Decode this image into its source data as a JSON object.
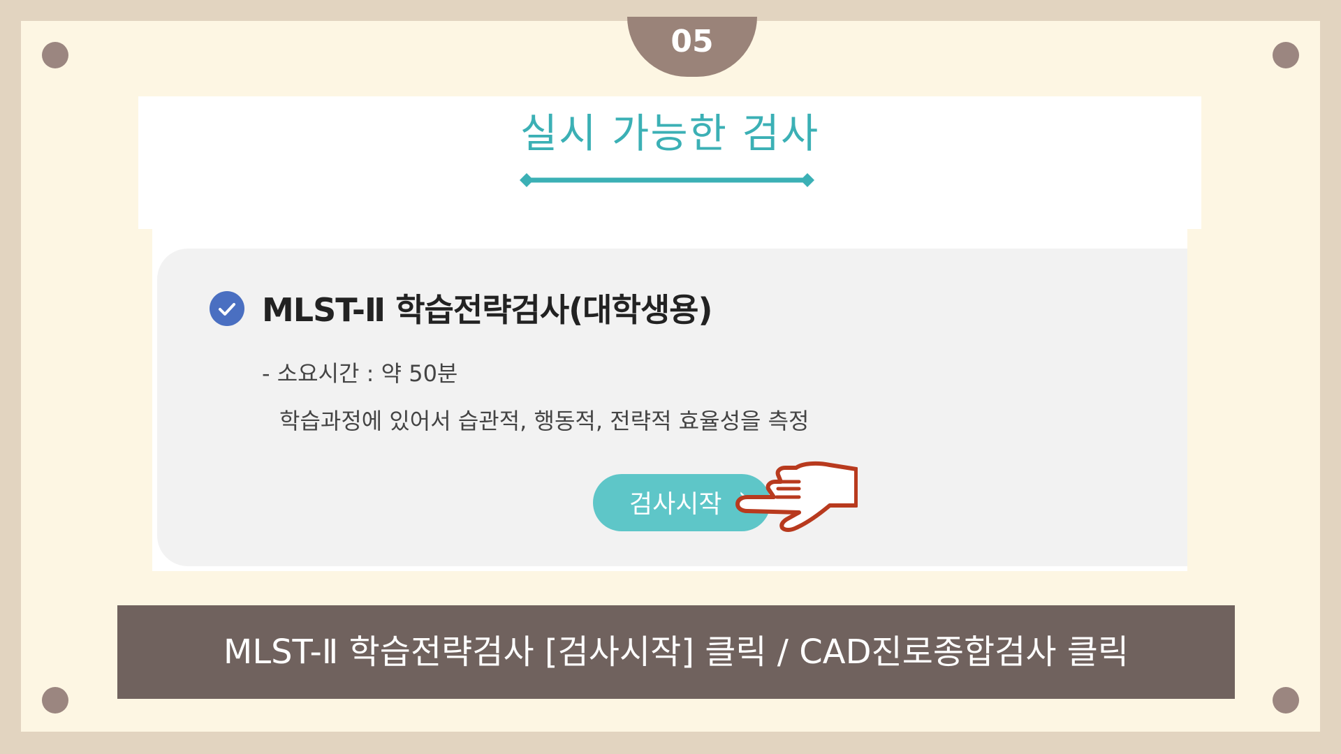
{
  "step": {
    "number": "05"
  },
  "screenshot": {
    "title": "실시 가능한 검사",
    "test": {
      "name": "MLST-Ⅱ 학습전략검사(대학생용)",
      "duration": "- 소요시간 : 약 50분",
      "description": "학습과정에 있어서 습관적, 행동적, 전략적 효율성을 측정",
      "start_button": "검사시작",
      "start_chevron": "›"
    }
  },
  "caption": "MLST-Ⅱ 학습전략검사 [검사시작] 클릭 / CAD진로종합검사 클릭",
  "icons": {
    "status": "check-circle-icon",
    "pointer": "pointing-hand-icon",
    "title_divider": "diamond-line-icon"
  },
  "colors": {
    "frame": "#e2d4c0",
    "board": "#fdf6e3",
    "accent_teal": "#3bb0b5",
    "button": "#5ec6c8",
    "check": "#4a6fc1",
    "caption_bar": "#70625e",
    "tab": "#9a8379",
    "hand_stroke": "#b83a1e"
  }
}
